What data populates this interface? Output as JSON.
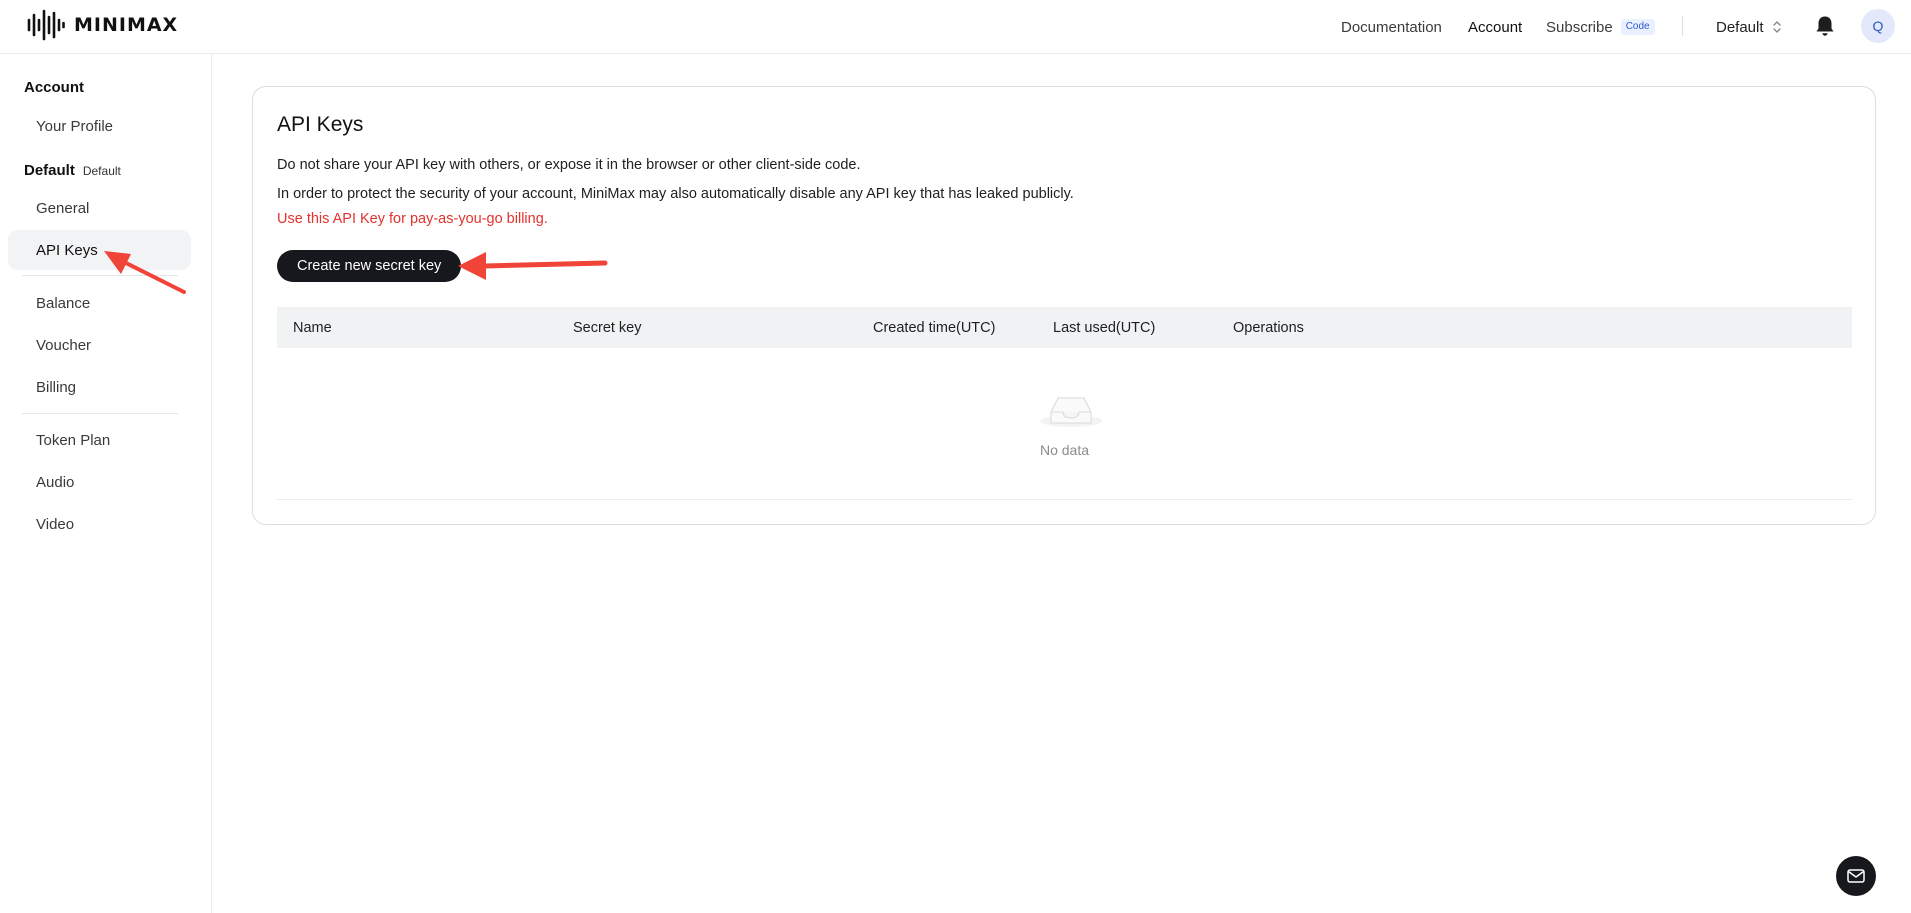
{
  "brand": {
    "name": "MINIMAX"
  },
  "header": {
    "nav": {
      "documentation": "Documentation",
      "account": "Account",
      "subscribe": "Subscribe",
      "subscribe_badge": "Code"
    },
    "org_selector": "Default",
    "avatar_initial": "Q"
  },
  "sidebar": {
    "account_section": "Account",
    "your_profile": "Your Profile",
    "default_section": "Default",
    "default_tag": "Default",
    "items": {
      "general": "General",
      "api_keys": "API Keys",
      "balance": "Balance",
      "voucher": "Voucher",
      "billing": "Billing",
      "token_plan": "Token Plan",
      "audio": "Audio",
      "video": "Video"
    },
    "active": "API Keys"
  },
  "main": {
    "title": "API Keys",
    "notice_1": "Do not share your API key with others, or expose it in the browser or other client-side code.",
    "notice_2": "In order to protect the security of your account, MiniMax may also automatically disable any API key that has leaked publicly.",
    "notice_red": "Use this API Key for pay-as-you-go billing.",
    "create_button": "Create new secret key",
    "table": {
      "columns": [
        "Name",
        "Secret key",
        "Created time(UTC)",
        "Last used(UTC)",
        "Operations"
      ],
      "rows": [],
      "empty_text": "No data"
    }
  },
  "colors": {
    "accent_red": "#e5322d",
    "button_dark": "#16181d",
    "active_bg": "#f2f3f5"
  }
}
